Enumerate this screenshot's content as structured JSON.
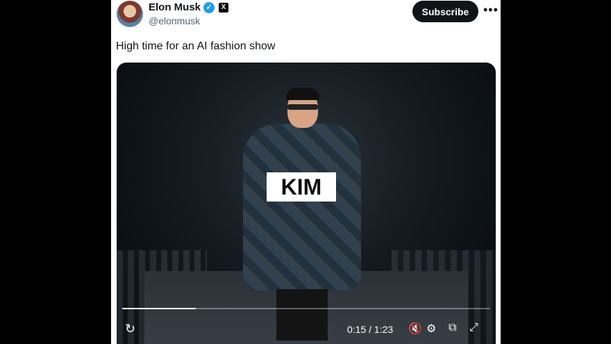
{
  "author": {
    "name": "Elon Musk",
    "handle": "@elonmusk"
  },
  "actions": {
    "subscribe": "Subscribe",
    "more": "•••"
  },
  "tweet": {
    "text": "High time for an AI fashion show"
  },
  "video": {
    "print_text": "KIM",
    "progress": 0.2,
    "current_time": "0:15",
    "separator": " / ",
    "duration": "1:23"
  },
  "icons": [
    "verified-icon",
    "x-logo-icon",
    "replay-icon",
    "mute-icon",
    "settings-icon",
    "pip-icon",
    "fullscreen-icon"
  ]
}
